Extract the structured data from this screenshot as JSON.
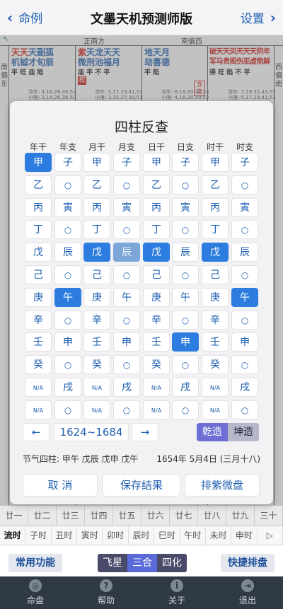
{
  "header": {
    "back_label": "命例",
    "title": "文墨天机预测师版",
    "settings_label": "设置"
  },
  "chart_bg": {
    "directions": {
      "left": "正南方",
      "right": "南偏西"
    },
    "palaces": [
      {
        "stars_red": "天天",
        "stars_blue": "天副孤",
        "line2": "机钺才旬辰",
        "status": "平 旺 庙 陷",
        "age1": "流年: 4,16,28,40,52",
        "age2": "小限: 2,14,26,38,50"
      },
      {
        "stars_red": "紫",
        "stars_blue": "天龙天天",
        "line2": "微刑池福月",
        "status": "庙 平 不 平",
        "age1": "流年: 5,17,29,41,53",
        "age2": "小限: 3,15,27,39,51"
      },
      {
        "stars_red": "",
        "stars_blue": "地天月",
        "line2": "劫喜德",
        "status": "平 陷",
        "age1": "流年: 6,18,30,42,54",
        "age2": "小限: 4,16,28,40,52"
      },
      {
        "stars_red": "破天天凤天天天阴年",
        "stars_blue": "",
        "line2": "军马贵阁伤巫虚煞解",
        "status": "得 旺 陷 不 平",
        "age1": "流年: 7,19,31,43,55",
        "age2": "小限: 5,17,29,41,53"
      }
    ],
    "side_left": "南偏东",
    "side_right": "西偏南",
    "badges": {
      "quan": "权",
      "shengong": "身宫"
    }
  },
  "modal": {
    "title": "四柱反查",
    "columns": [
      "年干",
      "年支",
      "月干",
      "月支",
      "日干",
      "日支",
      "时干",
      "时支"
    ],
    "rows": [
      {
        "stem": "甲",
        "branch": "子"
      },
      {
        "stem": "乙",
        "branch": "○"
      },
      {
        "stem": "丙",
        "branch": "寅"
      },
      {
        "stem": "丁",
        "branch": "○"
      },
      {
        "stem": "戊",
        "branch": "辰"
      },
      {
        "stem": "己",
        "branch": "○"
      },
      {
        "stem": "庚",
        "branch": "午"
      },
      {
        "stem": "辛",
        "branch": "○"
      },
      {
        "stem": "壬",
        "branch": "申"
      },
      {
        "stem": "癸",
        "branch": "○"
      },
      {
        "stem": "N/A",
        "branch": "戌"
      },
      {
        "stem": "N/A",
        "branch": "○"
      }
    ],
    "selected": {
      "year_stem": "甲",
      "year_branch": "午",
      "month_stem": "戊",
      "month_branch": "辰",
      "day_stem": "戊",
      "day_branch": "申",
      "hour_stem": "戊",
      "hour_branch": "午"
    },
    "year_range": "1624~1684",
    "prev_label": "←",
    "next_label": "→",
    "gender_male": "乾造",
    "gender_female": "坤造",
    "gender_selected": "乾造",
    "jieqi": "节气四柱: 甲午 戊辰 戊申 戊午",
    "date": "1654年 5月4日 (三月十八)",
    "cancel_label": "取 消",
    "save_label": "保存结果",
    "ziwei_label": "排紫微盘"
  },
  "calendar_strip": [
    "廿一",
    "廿二",
    "廿三",
    "廿四",
    "廿五",
    "廿六",
    "廿七",
    "廿八",
    "廿九",
    "三十"
  ],
  "liushi": [
    "流时",
    "子时",
    "丑时",
    "寅时",
    "卯时",
    "辰时",
    "巳时",
    "午时",
    "未时",
    "申时",
    "▷"
  ],
  "functions": {
    "common": "常用功能",
    "seg": [
      "飞星",
      "三合",
      "四化"
    ],
    "seg_active": "三合",
    "quick": "快捷排盘"
  },
  "tabs": [
    {
      "label": "命盘",
      "icon": "target-icon",
      "glyph": "◎"
    },
    {
      "label": "帮助",
      "icon": "help-icon",
      "glyph": "?"
    },
    {
      "label": "关于",
      "icon": "info-icon",
      "glyph": "i"
    },
    {
      "label": "退出",
      "icon": "exit-icon",
      "glyph": "⇥"
    }
  ],
  "colors": {
    "accent": "#1e5fb0",
    "selected": "#2d7de0",
    "tabbar": "#303a46",
    "gender_on": "#6d6fd6",
    "star_red": "#d0231c"
  }
}
